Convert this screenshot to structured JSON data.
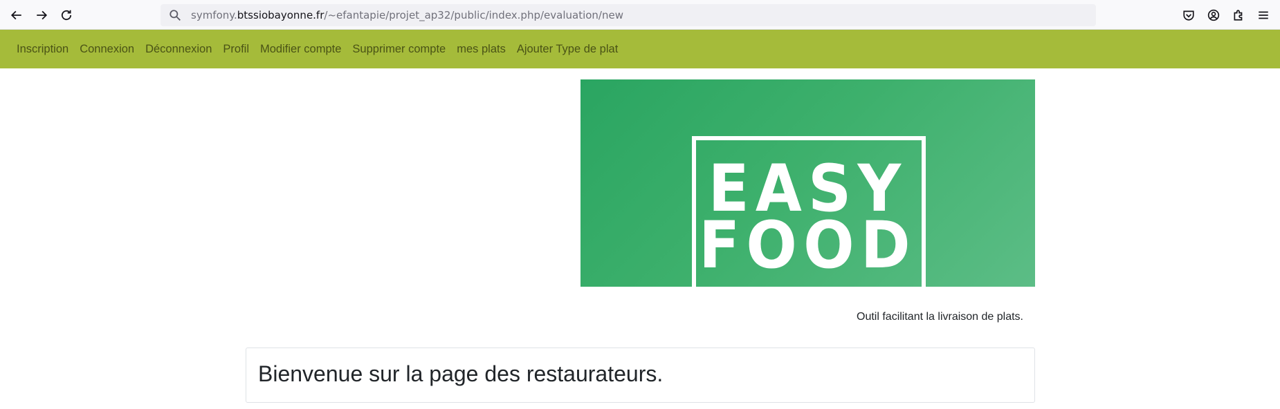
{
  "browser": {
    "url_prefix": "symfony.",
    "url_host": "btssiobayonne.fr",
    "url_path": "/~efantapie/projet_ap32/public/index.php/evaluation/new",
    "icons": [
      "back-icon",
      "forward-icon",
      "reload-icon",
      "search-icon",
      "pocket-icon",
      "account-icon",
      "extensions-icon",
      "menu-icon"
    ]
  },
  "nav": {
    "items": [
      {
        "label": "Inscription"
      },
      {
        "label": "Connexion"
      },
      {
        "label": "Déconnexion"
      },
      {
        "label": "Profil"
      },
      {
        "label": "Modifier compte"
      },
      {
        "label": "Supprimer compte"
      },
      {
        "label": "mes plats"
      },
      {
        "label": "Ajouter Type de plat"
      }
    ]
  },
  "banner": {
    "logo_line1": "EASY",
    "logo_line2": "FOOD"
  },
  "tagline": "Outil facilitant la livraison de plats.",
  "welcome": {
    "title": "Bienvenue sur la page des restaurateurs."
  },
  "colors": {
    "navbar": "#a5bb3a",
    "nav_text": "#4a5316",
    "banner_green": "#2aa561"
  }
}
